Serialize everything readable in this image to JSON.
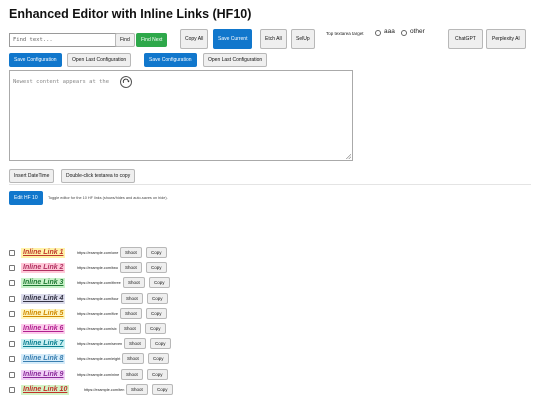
{
  "title": "Enhanced Editor with Inline Links (HF10)",
  "toolbar": {
    "search_placeholder": "Find text...",
    "find": "Find",
    "find_next": "Find Next",
    "copy_all": "Copy All",
    "save_current": "Save Current",
    "etch_all": "Etch All",
    "selup": "SelUp",
    "target_label": "Top textarea target",
    "target_options": [
      "aaa",
      "other"
    ],
    "chatgpt": "ChatGPT",
    "perplexity": "Perplexity AI"
  },
  "config": {
    "save_1": "Save Configuration",
    "open_1": "Open Last Configuration",
    "save_2": "Save Configuration",
    "open_2": "Open Last Configuration"
  },
  "editor": {
    "placeholder": "Newest content appears at the"
  },
  "actions": {
    "insert_datetime": "Insert DateTime",
    "dblclick_copy": "Double-click textarea to copy"
  },
  "hf": {
    "edit_button": "Edit HF 10",
    "hint": "Toggle editor for the 10 HF links (shows/hides and auto-saves on hide)."
  },
  "row_buttons": {
    "shoot": "Shoot",
    "copy": "Copy"
  },
  "links": [
    {
      "name": "Inline Link 1",
      "url": "https://example.com/one",
      "color": "#c0392b",
      "bg": "#fff2a8"
    },
    {
      "name": "Inline Link 2",
      "url": "https://example.com/two",
      "color": "#b03060",
      "bg": "#ffc8d8"
    },
    {
      "name": "Inline Link 3",
      "url": "https://example.com/three",
      "color": "#1f7a33",
      "bg": "#c8f2c8"
    },
    {
      "name": "Inline Link 4",
      "url": "https://example.com/four",
      "color": "#333344",
      "bg": "#dcdcec"
    },
    {
      "name": "Inline Link 5",
      "url": "https://example.com/five",
      "color": "#d08a00",
      "bg": "#fff6c0"
    },
    {
      "name": "Inline Link 6",
      "url": "https://example.com/six",
      "color": "#b0208f",
      "bg": "#fccdec"
    },
    {
      "name": "Inline Link 7",
      "url": "https://example.com/seven",
      "color": "#0b7f90",
      "bg": "#c8f0f2"
    },
    {
      "name": "Inline Link 8",
      "url": "https://example.com/eight",
      "color": "#3a7fb0",
      "bg": "#d6ecfa"
    },
    {
      "name": "Inline Link 9",
      "url": "https://example.com/nine",
      "color": "#8a2a9a",
      "bg": "#f0d0f6"
    },
    {
      "name": "Inline Link 10",
      "url": "https://example.com/ten",
      "color": "#c0302a",
      "bg": "#d2f2c4"
    }
  ]
}
